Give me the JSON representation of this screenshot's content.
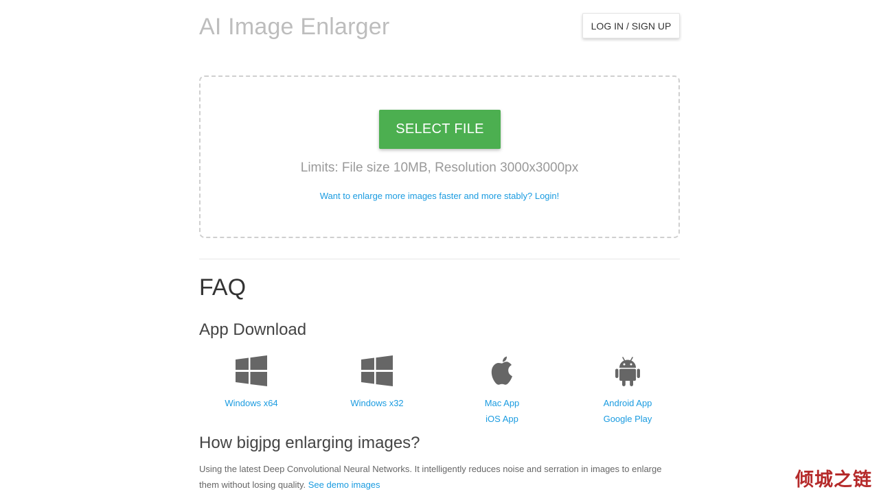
{
  "header": {
    "title": "AI Image Enlarger",
    "login_label": "LOG IN / SIGN UP"
  },
  "upload": {
    "select_label": "SELECT FILE",
    "limits_text": "Limits: File size 10MB, Resolution 3000x3000px",
    "login_prompt": "Want to enlarge more images faster and more stably? Login!"
  },
  "faq": {
    "title": "FAQ",
    "app_download_title": "App Download",
    "downloads": [
      {
        "icon": "windows-icon",
        "links": [
          "Windows x64"
        ]
      },
      {
        "icon": "windows-icon",
        "links": [
          "Windows x32"
        ]
      },
      {
        "icon": "apple-icon",
        "links": [
          "Mac App",
          "iOS App"
        ]
      },
      {
        "icon": "android-icon",
        "links": [
          "Android App",
          "Google Play"
        ]
      }
    ],
    "how_title": "How bigjpg enlarging images?",
    "how_text": "Using the latest Deep Convolutional Neural Networks. It intelligently reduces noise and serration in images to enlarge them without losing quality.",
    "demo_link": "See demo images"
  },
  "watermark": "倾城之链",
  "colors": {
    "accent_green": "#4caf50",
    "link_blue": "#1a9be0",
    "icon_gray": "#666666"
  }
}
